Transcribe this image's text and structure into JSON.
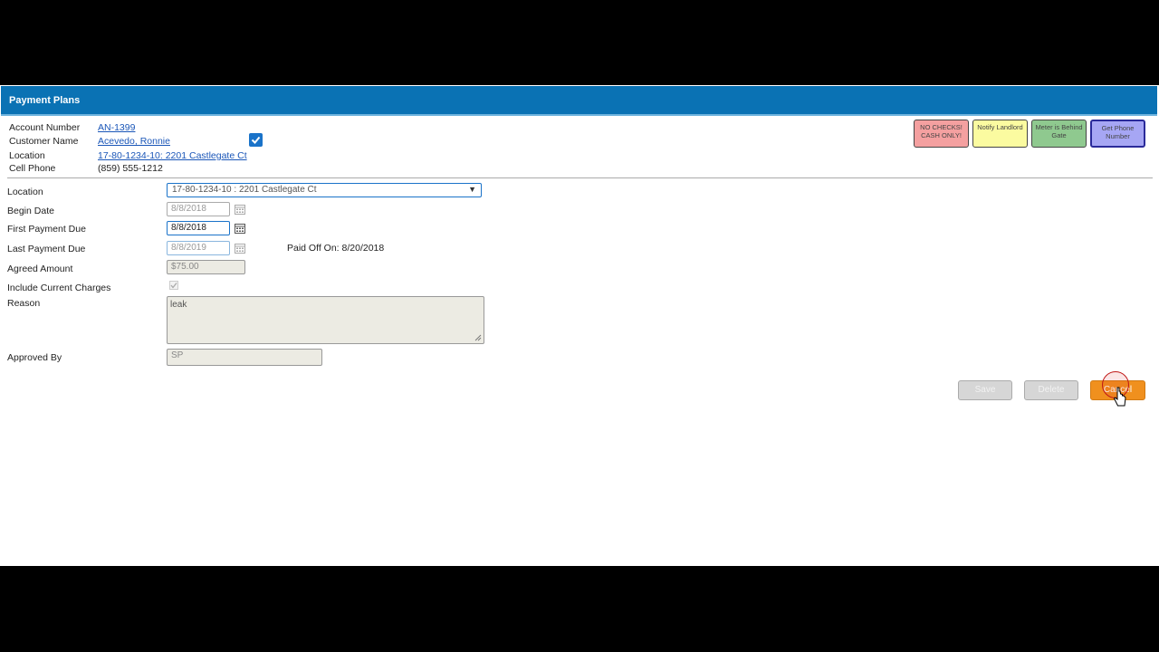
{
  "window": {
    "title": "Payment Plans"
  },
  "account": {
    "account_number_label": "Account Number",
    "account_number": "AN-1399",
    "customer_name_label": "Customer Name",
    "customer_name": "Acevedo, Ronnie",
    "location_label": "Location",
    "location": "17-80-1234-10: 2201 Castlegate Ct",
    "cell_phone_label": "Cell Phone",
    "cell_phone": "(859) 555-1212"
  },
  "tags": [
    {
      "text": "NO CHECKS! CASH ONLY!",
      "color": "#f4a0a0"
    },
    {
      "text": "Notify Landlord",
      "color": "#fbfba0"
    },
    {
      "text": "Meter is Behind Gate",
      "color": "#8fc98f"
    },
    {
      "text": "Get Phone Number",
      "color": "#a6a6f4"
    }
  ],
  "form": {
    "location_label": "Location",
    "location_value": "17-80-1234-10 : 2201 Castlegate Ct",
    "begin_date_label": "Begin Date",
    "begin_date": "8/8/2018",
    "first_payment_label": "First Payment Due",
    "first_payment": "8/8/2018",
    "last_payment_label": "Last Payment Due",
    "last_payment": "8/8/2019",
    "paid_off": "Paid Off On: 8/20/2018",
    "agreed_amount_label": "Agreed Amount",
    "agreed_amount": "$75.00",
    "include_charges_label": "Include Current Charges",
    "reason_label": "Reason",
    "reason": "leak",
    "approved_by_label": "Approved By",
    "approved_by": "SP"
  },
  "buttons": {
    "save": "Save",
    "delete": "Delete",
    "cancel": "Cancel"
  },
  "colors": {
    "titlebar": "#0a72b4",
    "accent": "#1a73c9",
    "cancel": "#f0901e"
  }
}
